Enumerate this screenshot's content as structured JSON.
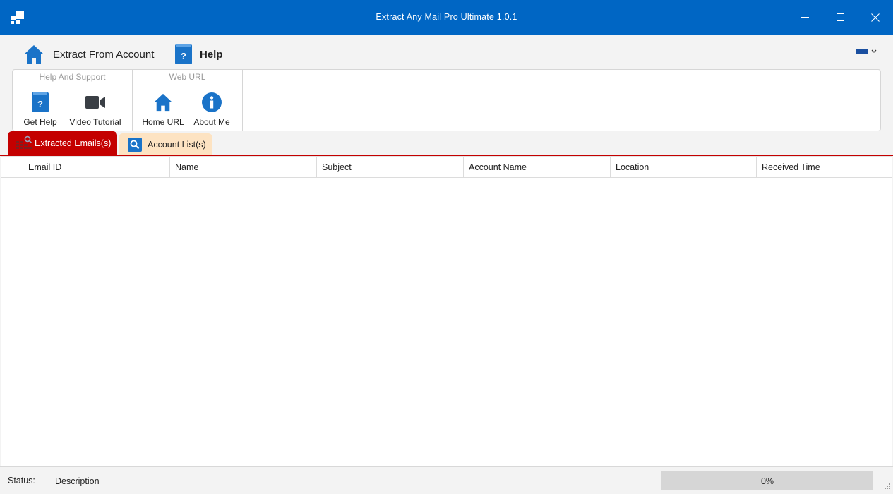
{
  "window": {
    "title": "Extract Any Mail Pro Ultimate 1.0.1",
    "accent_color": "#0066c4"
  },
  "ribbon": {
    "tabs": [
      {
        "label": "Extract From Account",
        "icon": "home-icon"
      },
      {
        "label": "Help",
        "icon": "help-book-icon",
        "active": true
      }
    ],
    "groups": [
      {
        "title": "Help And Support",
        "buttons": [
          {
            "label": "Get Help",
            "icon": "help-book-icon"
          },
          {
            "label": "Video Tutorial",
            "icon": "video-camera-icon"
          }
        ]
      },
      {
        "title": "Web URL",
        "buttons": [
          {
            "label": "Home URL",
            "icon": "home-icon"
          },
          {
            "label": "About Me",
            "icon": "info-icon"
          }
        ]
      }
    ]
  },
  "doc_tabs": [
    {
      "label": "Extracted Emails(s)",
      "icon": "grid-search-icon",
      "active": true,
      "color": "#c40000"
    },
    {
      "label": "Account List(s)",
      "icon": "search-icon",
      "active": false,
      "color": "#fde3c2"
    }
  ],
  "grid": {
    "columns": [
      "Email ID",
      "Name",
      "Subject",
      "Account Name",
      "Location",
      "Received Time"
    ],
    "rows": []
  },
  "status": {
    "label": "Status:",
    "description": "Description",
    "progress_text": "0%",
    "progress_fraction": 0
  }
}
